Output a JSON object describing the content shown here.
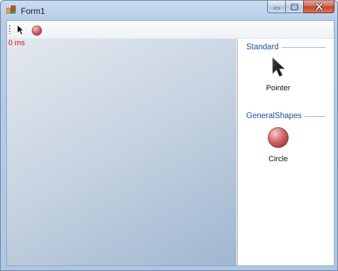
{
  "window": {
    "title": "Form1",
    "icons": {
      "app": "app-icon",
      "minimize": "minimize-icon",
      "maximize": "maximize-icon",
      "close": "close-icon"
    }
  },
  "toolstrip": {
    "items": [
      {
        "name": "pointer",
        "icon": "pointer-arrow-icon"
      },
      {
        "name": "circle",
        "icon": "red-circle-icon"
      }
    ]
  },
  "canvas": {
    "timing": "0 ms"
  },
  "toolbox": {
    "groups": [
      {
        "header": "Standard",
        "items": [
          {
            "label": "Pointer",
            "icon": "pointer-arrow-icon"
          }
        ]
      },
      {
        "header": "GeneralShapes",
        "items": [
          {
            "label": "Circle",
            "icon": "red-circle-icon"
          }
        ]
      }
    ]
  },
  "colors": {
    "timing_text": "#e01010",
    "group_header": "#1f4d9a",
    "circle_fill": "#d46a6a"
  }
}
